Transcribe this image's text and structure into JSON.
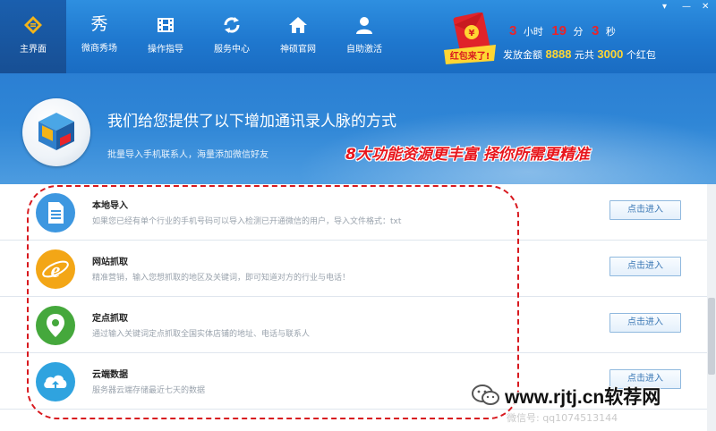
{
  "nav": {
    "items": [
      {
        "label": "主界面",
        "icon": "home-logo-icon",
        "active": true
      },
      {
        "label": "微商秀场",
        "icon": "xiu-glyph-icon"
      },
      {
        "label": "操作指导",
        "icon": "film-icon"
      },
      {
        "label": "服务中心",
        "icon": "refresh-icon"
      },
      {
        "label": "神硕官网",
        "icon": "house-icon"
      },
      {
        "label": "自助激活",
        "icon": "user-icon"
      }
    ],
    "xiu_glyph": "秀"
  },
  "window_controls": {
    "minimize": "—",
    "close": "✕",
    "menu": "▾"
  },
  "promo": {
    "badge_text": "红包来了!",
    "countdown": {
      "hours": "3",
      "hours_unit": "小时",
      "minutes": "19",
      "minutes_unit": "分",
      "seconds": "3",
      "seconds_unit": "秒"
    },
    "total_prefix": "发放金额",
    "amount": "8888",
    "amount_unit": "元共",
    "count": "3000",
    "count_unit": "个红包"
  },
  "banner": {
    "title": "我们给您提供了以下增加通讯录人脉的方式",
    "subtitle": "批量导入手机联系人，海量添加微信好友",
    "slogan": "8大功能资源更丰富 择你所需更精准"
  },
  "features": [
    {
      "title": "本地导入",
      "desc": "如果您已经有单个行业的手机号码可以导入检测已开通微信的用户，导入文件格式：txt",
      "button": "点击进入",
      "icon": "document-icon",
      "color": "#3d97e0"
    },
    {
      "title": "网站抓取",
      "desc": "精准营销，输入您想抓取的地区及关键词，即可知道对方的行业与电话！",
      "button": "点击进入",
      "icon": "browser-e-icon",
      "color": "#f3a616"
    },
    {
      "title": "定点抓取",
      "desc": "通过输入关键词定点抓取全国实体店铺的地址、电话与联系人",
      "button": "点击进入",
      "icon": "location-pin-icon",
      "color": "#45a83c"
    },
    {
      "title": "云端数据",
      "desc": "服务器云端存储最近七天的数据",
      "button": "点击进入",
      "icon": "cloud-upload-icon",
      "color": "#2fa3df"
    }
  ],
  "watermark": {
    "site": "www.rjtj.cn软荐网",
    "wechat": "微信号: qq1074513144"
  },
  "colors": {
    "topbar": "#1f78cf",
    "accent_red": "#e8161c",
    "gold": "#ffd633",
    "button_text": "#3b78b5"
  }
}
